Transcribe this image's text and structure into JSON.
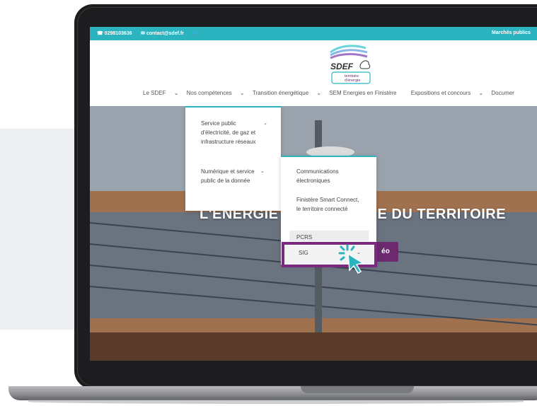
{
  "topbar": {
    "phone": "0298103636",
    "email": "contact@sdef.fr",
    "right_link": "Marchés publics"
  },
  "logo": {
    "name": "SDEF",
    "tagline_1": "territoire",
    "tagline_2": "d'énergie"
  },
  "nav": {
    "items": [
      {
        "label": "Le SDEF"
      },
      {
        "label": "Nos compétences"
      },
      {
        "label": "Transition énergétique"
      },
      {
        "label": "SEM Energies en Finistère"
      },
      {
        "label": "Expositions et concours"
      },
      {
        "label": "Documer"
      }
    ]
  },
  "dropdown1": {
    "items": [
      {
        "label": "Service public d'électricité, de gaz et infrastructure réseaux"
      },
      {
        "label": "Numérique et service public de la donnée"
      }
    ]
  },
  "dropdown2": {
    "items": [
      {
        "label": "Communications électroniques"
      },
      {
        "label": "Finistère Smart Connect, le territoire connecté"
      },
      {
        "label": "PCRS"
      },
      {
        "label": "SIG"
      }
    ]
  },
  "hero": {
    "title_left": "L'ÉNERGIE",
    "title_right": "E DU TERRITOIRE",
    "video_label": "éo"
  },
  "colors": {
    "accent": "#2bb3c0",
    "highlight": "#7b2a7f",
    "cursor": "#2bb3c0"
  }
}
